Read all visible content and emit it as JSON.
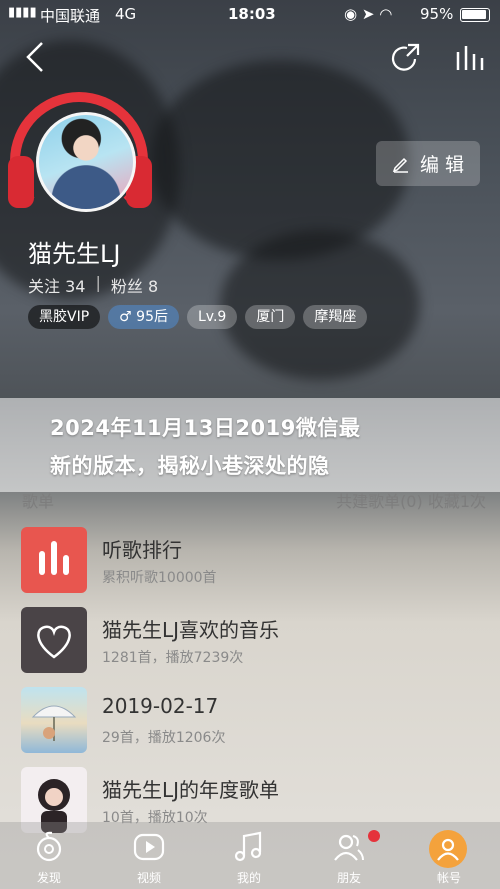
{
  "status": {
    "carrier": "中国联通",
    "network": "4G",
    "time": "18:03",
    "battery": "95%"
  },
  "profile": {
    "name": "猫先生LJ",
    "follow_label": "关注",
    "follow_count": "34",
    "fans_label": "粉丝",
    "fans_count": "8",
    "edit_label": "编 辑",
    "tags": [
      "黑胶VIP",
      "♂ 95后",
      "Lv.9",
      "厦门",
      "摩羯座"
    ]
  },
  "overlay": {
    "line1": "2024年11月13日2019微信最",
    "line2": "新的版本，揭秘小巷深处的隐"
  },
  "section": {
    "title": "歌单",
    "collected": "共建歌单(0) 收藏1次"
  },
  "playlists": [
    {
      "name": "听歌排行",
      "meta": "累积听歌10000首",
      "cover_icon": "bars-icon"
    },
    {
      "name": "猫先生LJ喜欢的音乐",
      "meta": "1281首，播放7239次",
      "cover_icon": "heart-icon"
    },
    {
      "name": "2019-02-17",
      "meta": "29首，播放1206次",
      "cover_icon": "umbrella-art"
    },
    {
      "name": "猫先生LJ的年度歌单",
      "meta": "10首，播放10次",
      "cover_icon": "portrait-art"
    }
  ],
  "tabs": [
    {
      "label": "发现",
      "icon": "discover-icon"
    },
    {
      "label": "视频",
      "icon": "video-icon"
    },
    {
      "label": "我的",
      "icon": "music-icon"
    },
    {
      "label": "朋友",
      "icon": "friends-icon"
    },
    {
      "label": "帐号",
      "icon": "account-icon"
    }
  ],
  "colors": {
    "accent": "#e5333b",
    "account_tab": "#f4a23c"
  }
}
